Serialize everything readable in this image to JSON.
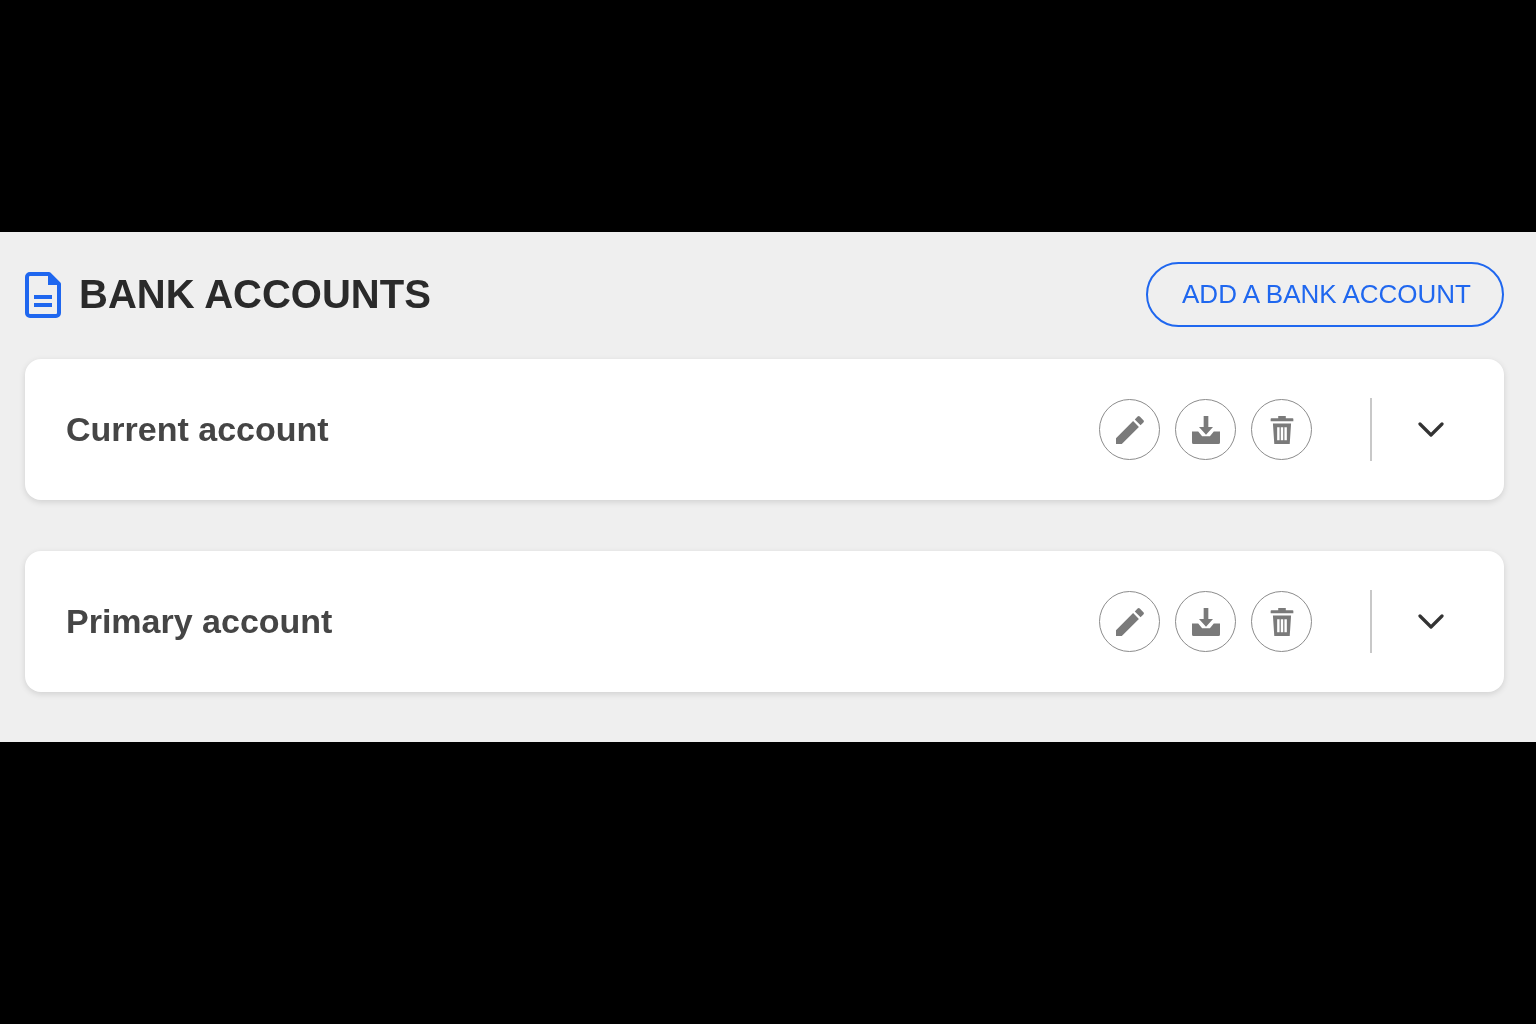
{
  "header": {
    "title": "BANK ACCOUNTS",
    "add_button": "ADD A BANK ACCOUNT"
  },
  "accounts": [
    {
      "name": "Current account",
      "expanded": false
    },
    {
      "name": "Primary account",
      "expanded": false
    }
  ]
}
